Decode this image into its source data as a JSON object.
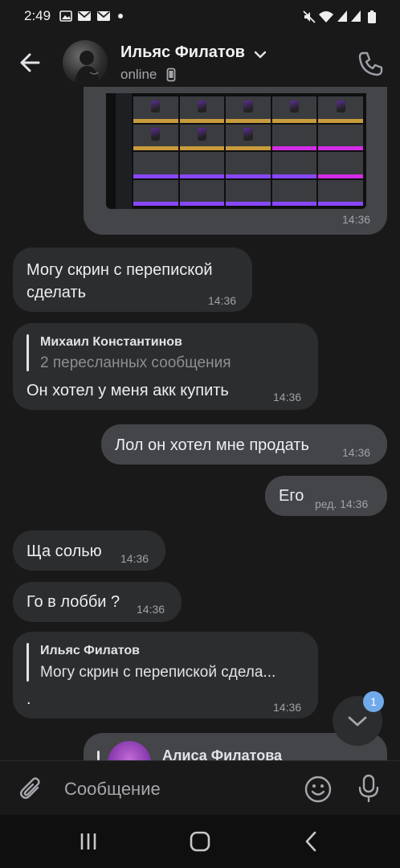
{
  "status_bar": {
    "time": "2:49",
    "icons": [
      "gallery-icon",
      "gmail-icon",
      "gmail-icon",
      "notification-dot-icon",
      "mute-icon",
      "wifi-icon",
      "signal-icon",
      "signal-icon",
      "battery-icon"
    ]
  },
  "header": {
    "name": "Ильяс Филатов",
    "status": "online",
    "icons": [
      "back-arrow-icon",
      "chevron-down-icon",
      "mobile-device-icon",
      "phone-icon"
    ]
  },
  "messages": [
    {
      "id": "m1",
      "direction": "out",
      "type": "image",
      "time": "14:36"
    },
    {
      "id": "m2",
      "direction": "in",
      "text": "Могу скрин с перепиской\nсделать",
      "time": "14:36"
    },
    {
      "id": "m3",
      "direction": "in",
      "forward_author": "Михаил Константинов",
      "forward_summary": "2 пересланных сообщения",
      "text": "Он хотел у меня акк купить",
      "time": "14:36"
    },
    {
      "id": "m4",
      "direction": "out",
      "text": "Лол он хотел мне продать",
      "time": "14:36"
    },
    {
      "id": "m5",
      "direction": "out",
      "text": "Его",
      "time": "ред. 14:36"
    },
    {
      "id": "m6",
      "direction": "in",
      "text": "Ща солью",
      "time": "14:36"
    },
    {
      "id": "m7",
      "direction": "in",
      "text": "Го в лобби ?",
      "time": "14:36"
    },
    {
      "id": "m8",
      "direction": "in",
      "reply_author": "Ильяс Филатов",
      "reply_text": "Могу скрин с перепиской сдела...",
      "text": ".",
      "time": "14:36"
    },
    {
      "id": "m9",
      "direction": "out",
      "forward_author": "Алиса Филатова"
    }
  ],
  "scroll_down": {
    "badge": "1",
    "icon": "chevron-down-icon"
  },
  "composer": {
    "placeholder": "Сообщение",
    "icons": [
      "paperclip-icon",
      "emoji-icon",
      "microphone-icon"
    ]
  },
  "nav_bar": {
    "icons": [
      "recent-apps-icon",
      "home-icon",
      "back-icon"
    ]
  },
  "colors": {
    "background": "#19191a",
    "bubble_in": "#2c2d2e",
    "bubble_out": "#444548",
    "badge": "#71aaeb",
    "text": "#e1e3e6",
    "secondary_text": "#a5a7ab"
  }
}
